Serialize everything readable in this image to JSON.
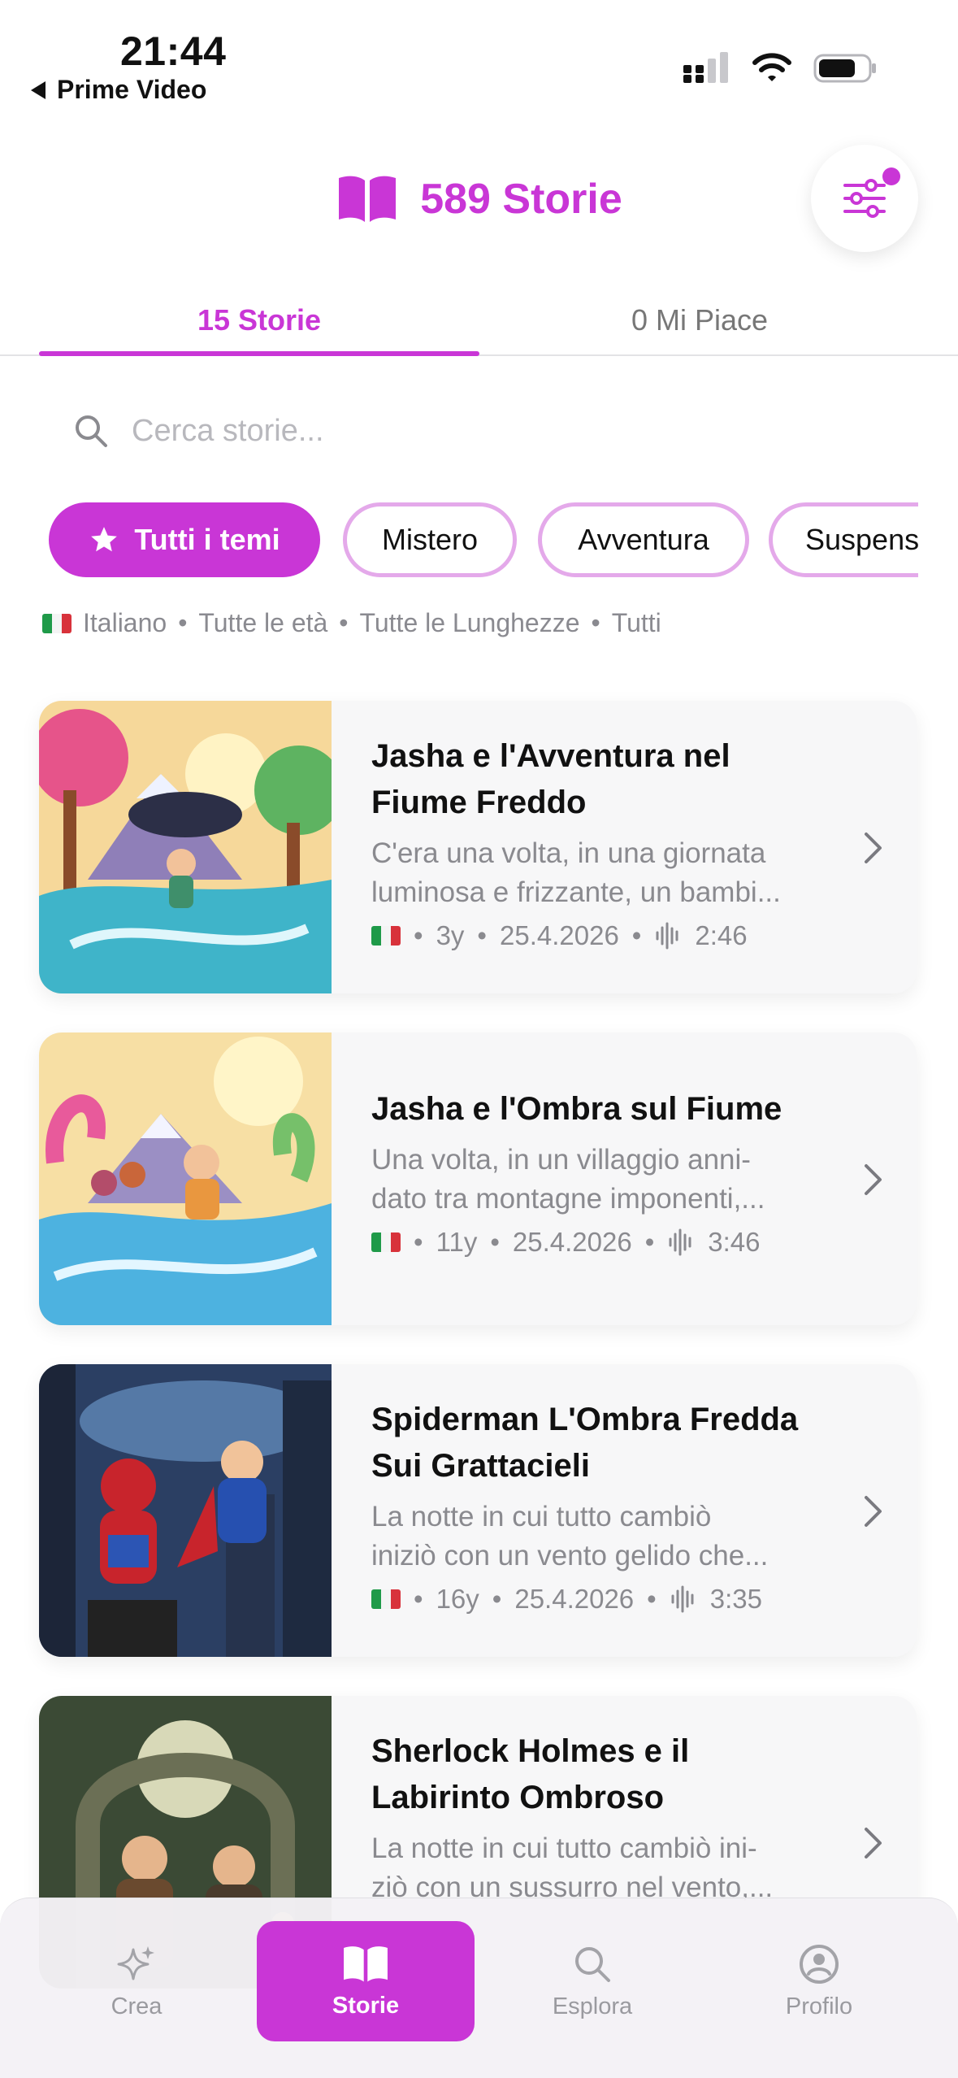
{
  "status_bar": {
    "time": "21:44",
    "back_app": "Prime Video"
  },
  "header": {
    "title": "589 Storie",
    "icons": [
      "book-icon",
      "filter-icon"
    ]
  },
  "tabs": [
    {
      "label": "15 Storie",
      "active": true
    },
    {
      "label": "0 Mi Piace",
      "active": false
    }
  ],
  "search": {
    "placeholder": "Cerca storie..."
  },
  "chips": [
    {
      "label": "Tutti i temi",
      "active": true,
      "icon": "star-icon"
    },
    {
      "label": "Mistero",
      "active": false
    },
    {
      "label": "Avventura",
      "active": false
    },
    {
      "label": "Suspense",
      "active": false
    }
  ],
  "filters": {
    "language": "Italiano",
    "age": "Tutte le età",
    "length": "Tutte le Lunghezze",
    "type": "Tutti",
    "separator": "•"
  },
  "stories": [
    {
      "title_l1": "Jasha e l'Avventura nel",
      "title_l2": "Fiume Freddo",
      "desc_l1": "C'era una volta, in una giornata",
      "desc_l2": "luminosa e frizzante, un bambi...",
      "age": "3y",
      "date": "25.4.2026",
      "duration": "2:46"
    },
    {
      "title_l1": "Jasha e l'Ombra sul Fiume",
      "title_l2": "",
      "desc_l1": "Una volta, in un villaggio anni-",
      "desc_l2": "dato tra montagne imponenti,...",
      "age": "11y",
      "date": "25.4.2026",
      "duration": "3:46"
    },
    {
      "title_l1": "Spiderman L'Ombra Fredda",
      "title_l2": "Sui Grattacieli",
      "desc_l1": "La notte in cui tutto cambiò",
      "desc_l2": "iniziò con un vento gelido che...",
      "age": "16y",
      "date": "25.4.2026",
      "duration": "3:35"
    },
    {
      "title_l1": "Sherlock Holmes e il",
      "title_l2": "Labirinto Ombroso",
      "desc_l1": "La notte in cui tutto cambiò ini-",
      "desc_l2": "ziò con un sussurro nel vento,...",
      "age": "",
      "date": "",
      "duration": ""
    }
  ],
  "nav": [
    {
      "label": "Crea",
      "icon": "sparkle-icon",
      "active": false
    },
    {
      "label": "Storie",
      "icon": "book-icon",
      "active": true
    },
    {
      "label": "Esplora",
      "icon": "search-icon",
      "active": false
    },
    {
      "label": "Profilo",
      "icon": "profile-icon",
      "active": false
    }
  ],
  "colors": {
    "accent": "#c936d6",
    "chip_border": "#e4a9ea",
    "muted": "#8a8a8f"
  }
}
